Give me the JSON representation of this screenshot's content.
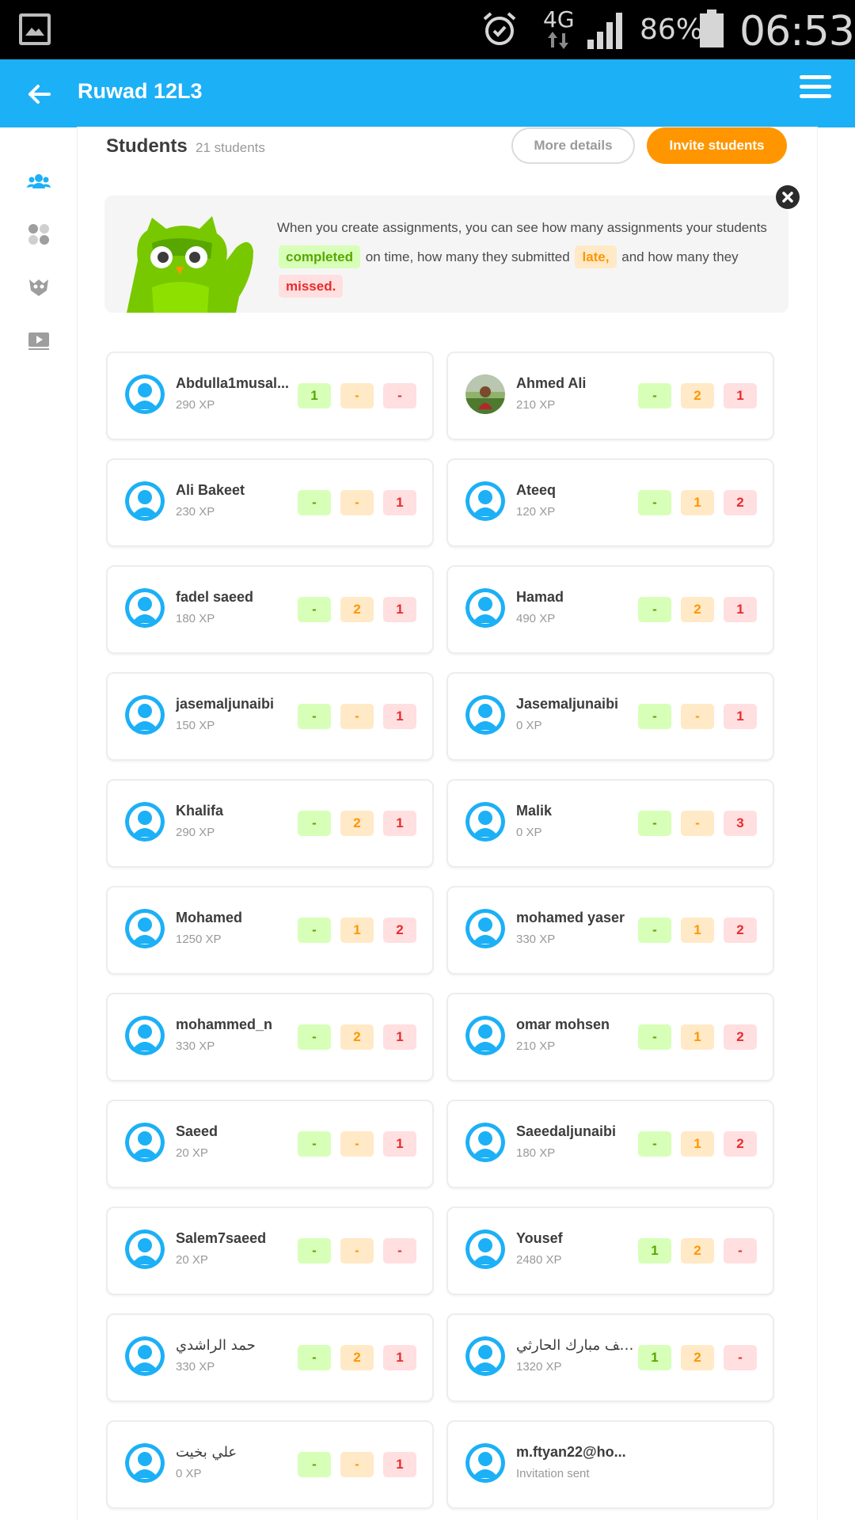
{
  "status_bar": {
    "network": "4G",
    "battery": "86%",
    "time": "06:53"
  },
  "app_bar": {
    "title": "Ruwad 12L3"
  },
  "header": {
    "title": "Students",
    "count": "21 students",
    "more_details": "More details",
    "invite": "Invite students"
  },
  "info": {
    "part1": "When you create assignments, you can see how many assignments your students",
    "completed": "completed",
    "part2": "on time, how many they submitted",
    "late": "late,",
    "part3": "and how many they",
    "missed": "missed."
  },
  "students": [
    {
      "name": "Abdulla1musal...",
      "xp": "290 XP",
      "completed": "1",
      "late": "-",
      "missed": "-",
      "avatar": "default"
    },
    {
      "name": "Ahmed Ali",
      "xp": "210 XP",
      "completed": "-",
      "late": "2",
      "missed": "1",
      "avatar": "photo"
    },
    {
      "name": "Ali Bakeet",
      "xp": "230 XP",
      "completed": "-",
      "late": "-",
      "missed": "1",
      "avatar": "default"
    },
    {
      "name": "Ateeq",
      "xp": "120 XP",
      "completed": "-",
      "late": "1",
      "missed": "2",
      "avatar": "default"
    },
    {
      "name": "fadel saeed",
      "xp": "180 XP",
      "completed": "-",
      "late": "2",
      "missed": "1",
      "avatar": "default"
    },
    {
      "name": "Hamad",
      "xp": "490 XP",
      "completed": "-",
      "late": "2",
      "missed": "1",
      "avatar": "default"
    },
    {
      "name": "jasemaljunaibi",
      "xp": "150 XP",
      "completed": "-",
      "late": "-",
      "missed": "1",
      "avatar": "default"
    },
    {
      "name": "Jasemaljunaibi",
      "xp": "0 XP",
      "completed": "-",
      "late": "-",
      "missed": "1",
      "avatar": "default"
    },
    {
      "name": "Khalifa",
      "xp": "290 XP",
      "completed": "-",
      "late": "2",
      "missed": "1",
      "avatar": "default"
    },
    {
      "name": "Malik",
      "xp": "0 XP",
      "completed": "-",
      "late": "-",
      "missed": "3",
      "avatar": "default"
    },
    {
      "name": "Mohamed",
      "xp": "1250 XP",
      "completed": "-",
      "late": "1",
      "missed": "2",
      "avatar": "default"
    },
    {
      "name": "mohamed yaser",
      "xp": "330 XP",
      "completed": "-",
      "late": "1",
      "missed": "2",
      "avatar": "default"
    },
    {
      "name": "mohammed_n",
      "xp": "330 XP",
      "completed": "-",
      "late": "2",
      "missed": "1",
      "avatar": "default"
    },
    {
      "name": "omar mohsen",
      "xp": "210 XP",
      "completed": "-",
      "late": "1",
      "missed": "2",
      "avatar": "default"
    },
    {
      "name": "Saeed",
      "xp": "20 XP",
      "completed": "-",
      "late": "-",
      "missed": "1",
      "avatar": "default"
    },
    {
      "name": "Saeedaljunaibi",
      "xp": "180 XP",
      "completed": "-",
      "late": "1",
      "missed": "2",
      "avatar": "default"
    },
    {
      "name": "Salem7saeed",
      "xp": "20 XP",
      "completed": "-",
      "late": "-",
      "missed": "-",
      "avatar": "default"
    },
    {
      "name": "Yousef",
      "xp": "2480 XP",
      "completed": "1",
      "late": "2",
      "missed": "-",
      "avatar": "default"
    },
    {
      "name": "حمد الراشدي",
      "xp": "330 XP",
      "completed": "-",
      "late": "2",
      "missed": "1",
      "avatar": "default"
    },
    {
      "name": "سيف مبارك الحارثي",
      "xp": "1320 XP",
      "completed": "1",
      "late": "2",
      "missed": "-",
      "avatar": "default"
    },
    {
      "name": "علي بخيت",
      "xp": "0 XP",
      "completed": "-",
      "late": "-",
      "missed": "1",
      "avatar": "default"
    },
    {
      "name": "m.ftyan22@ho...",
      "xp": "Invitation sent",
      "avatar": "default",
      "invited": true
    }
  ],
  "colors": {
    "app_bar": "#1cb0f6",
    "accent": "#ff9600",
    "completed": "#58a700",
    "late": "#ff9600",
    "missed": "#ea2b2b"
  }
}
